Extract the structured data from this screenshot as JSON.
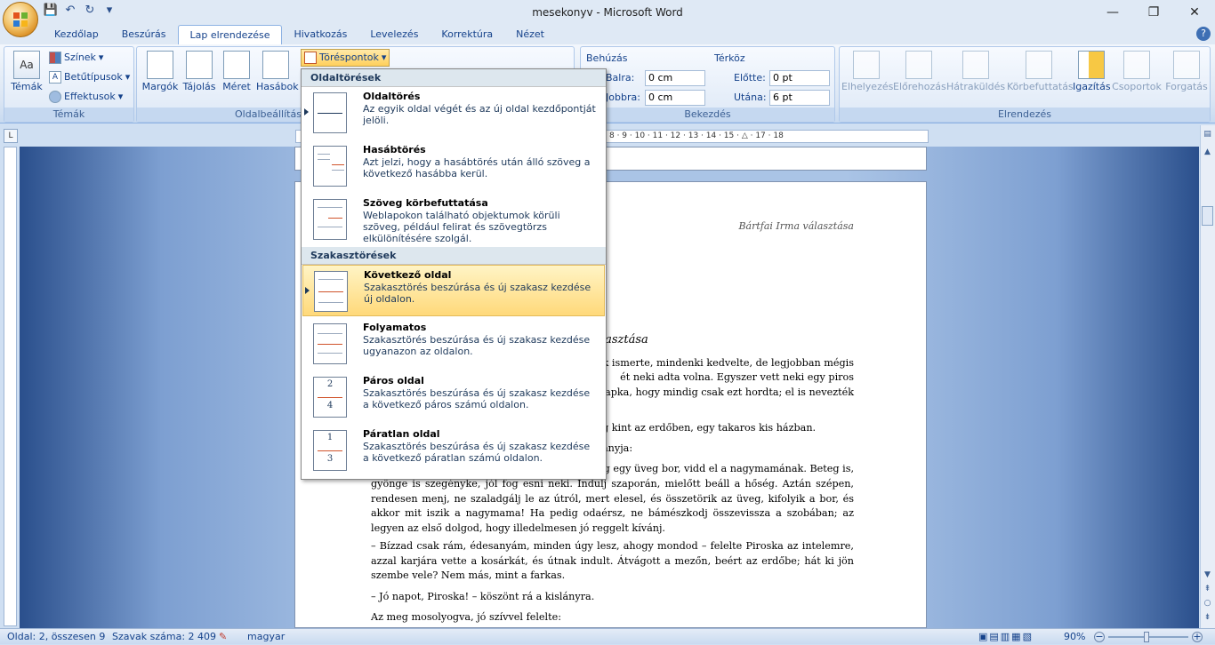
{
  "window": {
    "title": "mesekonyv - Microsoft Word"
  },
  "qat": {
    "save": "💾",
    "undo": "↶",
    "redo": "↻",
    "more": "▾"
  },
  "tabs": [
    "Kezdőlap",
    "Beszúrás",
    "Lap elrendezése",
    "Hivatkozás",
    "Levelezés",
    "Korrektúra",
    "Nézet"
  ],
  "active_tab": "Lap elrendezése",
  "ribbon": {
    "temak": {
      "big": "Témák",
      "colors": "Színek",
      "fonts": "Betűtípusok",
      "effects": "Effektusok",
      "title": "Témák"
    },
    "oldal": {
      "margins": "Margók",
      "orientation": "Tájolás",
      "size": "Méret",
      "columns": "Hasábok",
      "breaks": "Töréspontok",
      "title": "Oldalbeállítás"
    },
    "behuzas": {
      "title": "Behúzás",
      "left_label": "Balra:",
      "left_val": "0 cm",
      "right_label": "Jobbra:",
      "right_val": "0 cm"
    },
    "terkoz": {
      "title": "Térköz",
      "before_label": "Előtte:",
      "before_val": "0 pt",
      "after_label": "Utána:",
      "after_val": "6 pt"
    },
    "bekezdes_title": "Bekezdés",
    "elrendezes": {
      "items": [
        "Elhelyezés",
        "Előrehozás",
        "Hátraküldés",
        "Körbefuttatás",
        "Igazítás",
        "Csoportok",
        "Forgatás"
      ],
      "title": "Elrendezés"
    }
  },
  "ruler": {
    "ticks": "8 · 9 · 10 · 11 · 12 · 13 · 14 · 15 · △ · 17 · 18"
  },
  "menu": {
    "section1": "Oldaltörések",
    "section2": "Szakasztörések",
    "items": [
      {
        "title": "Oldaltörés",
        "desc": "Az egyik oldal végét és az új oldal kezdőpontját jelöli."
      },
      {
        "title": "Hasábtörés",
        "desc": "Azt jelzi, hogy a hasábtörés után álló szöveg a következő hasábba kerül."
      },
      {
        "title": "Szöveg körbefuttatása",
        "desc": "Weblapokon található objektumok körüli szöveg, például felirat és szövegtörzs elkülönítésére szolgál."
      },
      {
        "title": "Következő oldal",
        "desc": "Szakasztörés beszúrása és új szakasz kezdése új oldalon."
      },
      {
        "title": "Folyamatos",
        "desc": "Szakasztörés beszúrása és új szakasz kezdése ugyanazon az oldalon."
      },
      {
        "title": "Páros oldal",
        "desc": "Szakasztörés beszúrása és új szakasz kezdése a következő páros számú oldalon."
      },
      {
        "title": "Páratlan oldal",
        "desc": "Szakasztörés beszúrása és új szakasz kezdése a következő páratlan számú oldalon."
      }
    ],
    "page_nums": {
      "even_top": "2",
      "even_bottom": "4",
      "odd_top": "1",
      "odd_bottom": "3"
    }
  },
  "document": {
    "header": "Bártfai Irma választása",
    "heading_fragment": "a választása",
    "lines": [
      "ak ismerte, mindenki kedvelte, de legjobban mégis",
      "ét neki adta volna. Egyszer vett neki egy piros",
      "sapka, hogy mindig csak ezt hordta; el is nevezték",
      "g kint az erdőben, egy takaros kis házban.",
      "anyja:",
      "g egy üveg bor, vidd el a nagymamának. Beteg is,"
    ],
    "paragraphs": [
      "gyönge is szegényke, jól fog esni neki. Indulj szaporán, mielőtt beáll a hőség. Aztán szépen, rendesen menj, ne szaladgálj le az útról, mert elesel, és összetörik az üveg, kifolyik a bor, és akkor mit iszik a nagymama! Ha pedig odaérsz, ne bámészkodj összevissza a szobában; az legyen az első dolgod, hogy illedelmesen jó reggelt kívánj.",
      "– Bízzad csak rám, édesanyám, minden úgy lesz, ahogy mondod – felelte Piroska az intelemre, azzal karjára vette a kosárkát, és útnak indult. Átvágott a mezőn, beért az erdőbe; hát ki jön szembe vele? Nem más, mint a farkas.",
      "– Jó napot, Piroska! – köszönt rá a kislányra.",
      "Az meg mosolyogva, jó szívvel felelte:"
    ]
  },
  "status": {
    "page": "Oldal: 2, összesen 9",
    "words": "Szavak száma: 2 409",
    "language": "magyar",
    "zoom": "90%"
  }
}
